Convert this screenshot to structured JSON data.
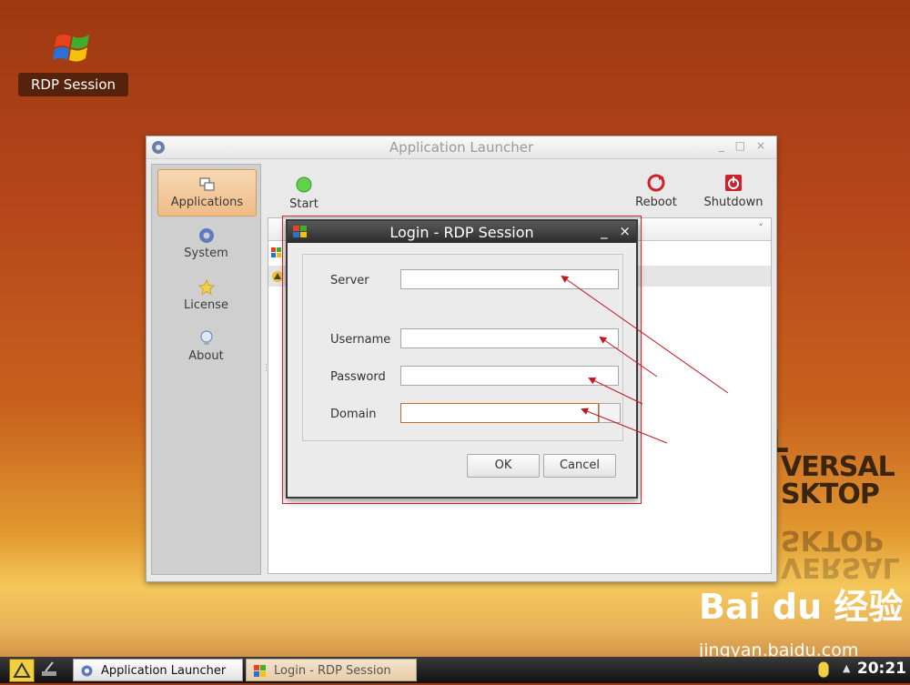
{
  "desktop": {
    "icon_label": "RDP Session",
    "wallpaper_text": {
      "l": "L",
      "versal": "VERSAL",
      "sktop": "SKTOP",
      "reflection1": "SKTOP",
      "reflection2": "VERSAL"
    },
    "watermark": {
      "brand": "Bai du 经验",
      "url": "jingyan.baidu.com"
    }
  },
  "launcher": {
    "title": "Application Launcher",
    "window_buttons": "_ □ ×",
    "sidebar": [
      {
        "label": "Applications",
        "icon": "applications-icon",
        "active": true
      },
      {
        "label": "System",
        "icon": "gear-icon",
        "active": false
      },
      {
        "label": "License",
        "icon": "star-icon",
        "active": false
      },
      {
        "label": "About",
        "icon": "bulb-icon",
        "active": false
      }
    ],
    "toolbar": {
      "start_label": "Start",
      "reboot_label": "Reboot",
      "shutdown_label": "Shutdown"
    },
    "list_header_chevron": "˅"
  },
  "dialog": {
    "title": "Login - RDP Session",
    "minimize": "_",
    "close": "×",
    "fields": {
      "server_label": "Server",
      "server_value": "",
      "username_label": "Username",
      "username_value": "",
      "password_label": "Password",
      "password_value": "",
      "domain_label": "Domain",
      "domain_value": ""
    },
    "ok_label": "OK",
    "cancel_label": "Cancel"
  },
  "taskbar": {
    "tasks": [
      {
        "label": "Application Launcher",
        "icon": "gear-icon"
      },
      {
        "label": "Login - RDP Session",
        "icon": "windows-logo-icon"
      }
    ],
    "clock": "20:21"
  },
  "colors": {
    "annotation_red": "#d0202a",
    "active_tab": "#efbb86",
    "desktop_orange": "#b5461a"
  }
}
